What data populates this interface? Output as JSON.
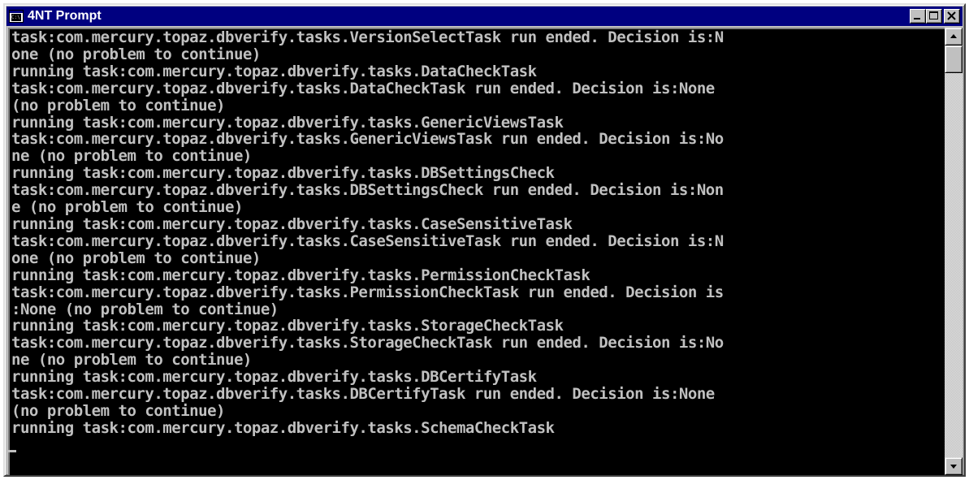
{
  "window": {
    "title": "4NT Prompt",
    "icon": "console-window-icon",
    "icon_glyph": "C:\\"
  },
  "title_buttons": {
    "minimize_icon": "minimize-icon",
    "maximize_icon": "maximize-icon",
    "close_icon": "close-icon"
  },
  "console": {
    "lines": [
      "task:com.mercury.topaz.dbverify.tasks.VersionSelectTask run ended. Decision is:N",
      "one (no problem to continue)",
      "running task:com.mercury.topaz.dbverify.tasks.DataCheckTask",
      "task:com.mercury.topaz.dbverify.tasks.DataCheckTask run ended. Decision is:None",
      "(no problem to continue)",
      "running task:com.mercury.topaz.dbverify.tasks.GenericViewsTask",
      "task:com.mercury.topaz.dbverify.tasks.GenericViewsTask run ended. Decision is:No",
      "ne (no problem to continue)",
      "running task:com.mercury.topaz.dbverify.tasks.DBSettingsCheck",
      "task:com.mercury.topaz.dbverify.tasks.DBSettingsCheck run ended. Decision is:Non",
      "e (no problem to continue)",
      "running task:com.mercury.topaz.dbverify.tasks.CaseSensitiveTask",
      "task:com.mercury.topaz.dbverify.tasks.CaseSensitiveTask run ended. Decision is:N",
      "one (no problem to continue)",
      "running task:com.mercury.topaz.dbverify.tasks.PermissionCheckTask",
      "task:com.mercury.topaz.dbverify.tasks.PermissionCheckTask run ended. Decision is",
      ":None (no problem to continue)",
      "running task:com.mercury.topaz.dbverify.tasks.StorageCheckTask",
      "task:com.mercury.topaz.dbverify.tasks.StorageCheckTask run ended. Decision is:No",
      "ne (no problem to continue)",
      "running task:com.mercury.topaz.dbverify.tasks.DBCertifyTask",
      "task:com.mercury.topaz.dbverify.tasks.DBCertifyTask run ended. Decision is:None",
      "(no problem to continue)",
      "running task:com.mercury.topaz.dbverify.tasks.SchemaCheckTask"
    ]
  },
  "scrollbar": {
    "up_icon": "scroll-up-arrow-icon",
    "down_icon": "scroll-down-arrow-icon"
  },
  "colors": {
    "titlebar": "#000080",
    "console_bg": "#000000",
    "console_text": "#c0c0c0",
    "chrome": "#c0c0c0"
  }
}
